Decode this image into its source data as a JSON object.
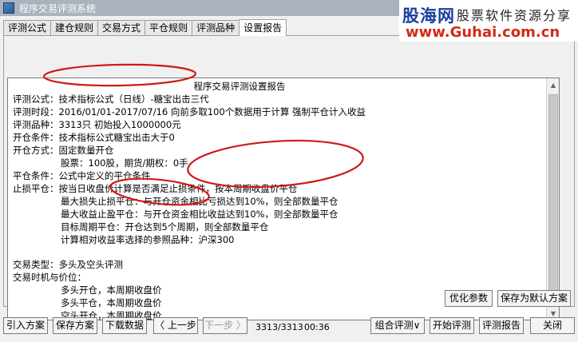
{
  "window": {
    "title": "程序交易评测系统"
  },
  "watermark": {
    "logo": "股海网",
    "slogan": "股票软件资源分享",
    "url": "www.Guhai.com.cn"
  },
  "tabs": [
    {
      "label": "评测公式"
    },
    {
      "label": "建仓规则"
    },
    {
      "label": "交易方式"
    },
    {
      "label": "平仓规则"
    },
    {
      "label": "评测品种"
    },
    {
      "label": "设置报告",
      "active": true
    }
  ],
  "report": {
    "title": "程序交易评测设置报告",
    "lines": [
      "评测公式：技术指标公式（日线）-糖宝出击三代",
      "评测时段：2016/01/01-2017/07/16 向前多取100个数据用于计算 强制平仓计入收益",
      "评测品种：3313只 初始投入1000000元",
      "开仓条件：技术指标公式糖宝出击大于0",
      "开仓方式：固定数量开仓",
      "股票：100股，期货/期权：0手",
      "平仓条件：公式中定义的平仓条件",
      "止损平仓：按当日收盘价计算是否满足止损条件，按本周期收盘价平仓",
      "最大损失止损平仓：与开仓资金相比亏损达到10%，则全部数量平仓",
      "最大收益止盈平仓：与开仓资金相比收益达到10%，则全部数量平仓",
      "目标周期平仓：开仓达到5个周期，则全部数量平仓",
      "计算相对收益率选择的参照品种：沪深300",
      "交易类型：多头及空头评测",
      "交易时机与价位：",
      "多头开仓，本周期收盘价",
      "多头平仓，本周期收盘价",
      "空头开仓，本周期收盘价"
    ]
  },
  "panel_buttons": {
    "optimize": "优化参数",
    "save_default": "保存为默认方案"
  },
  "bottom_bar": {
    "import": "引入方案",
    "save": "保存方案",
    "download": "下载数据",
    "prev": "〈 上一步",
    "next": "下一步 〉",
    "progress": "3313/3313",
    "time": "00:36",
    "combo": "组合评测∨",
    "start": "开始评测",
    "report": "评测报告",
    "close": "关闭"
  },
  "colors": {
    "annotation": "#d01818",
    "titlebar": "#a9b2bd",
    "watermark_logo": "#1a3fa0",
    "watermark_url": "#d32a16"
  }
}
